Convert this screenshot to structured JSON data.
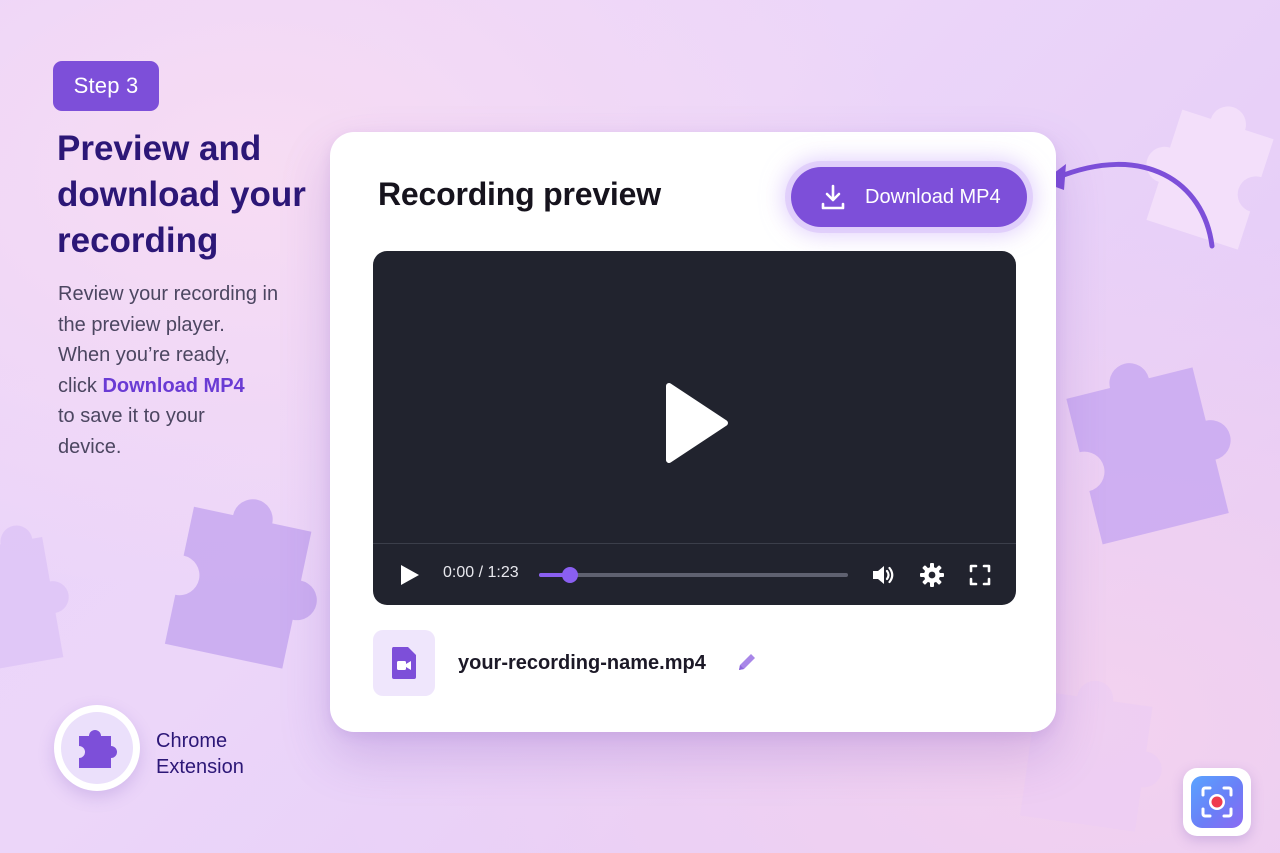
{
  "step": {
    "label": "Step 3"
  },
  "headline": {
    "line1": "Preview and",
    "line2": "download your",
    "line3": "recording"
  },
  "description": {
    "line1": "Review your recording in",
    "line2": "the preview player.",
    "line3": "When you’re ready,",
    "line4_prefix": "click ",
    "line4_highlight": "Download MP4",
    "line5": "to save it to your",
    "line6": "device."
  },
  "extension": {
    "line1": "Chrome",
    "line2": "Extension",
    "icon": "puzzle-icon"
  },
  "card": {
    "title": "Recording preview",
    "download_button": {
      "label": "Download MP4",
      "icon": "download-icon"
    }
  },
  "player": {
    "time": "0:00 / 1:23",
    "progress": 0.1,
    "icons": [
      "play-icon",
      "volume-icon",
      "settings-icon",
      "fullscreen-icon"
    ]
  },
  "file": {
    "name": "your-recording-name.mp4",
    "icon": "video-file-icon",
    "edit_icon": "pencil-icon"
  },
  "colors": {
    "accent": "#7d4fd9",
    "headline": "#2c1777",
    "player_bg": "#21232e"
  }
}
